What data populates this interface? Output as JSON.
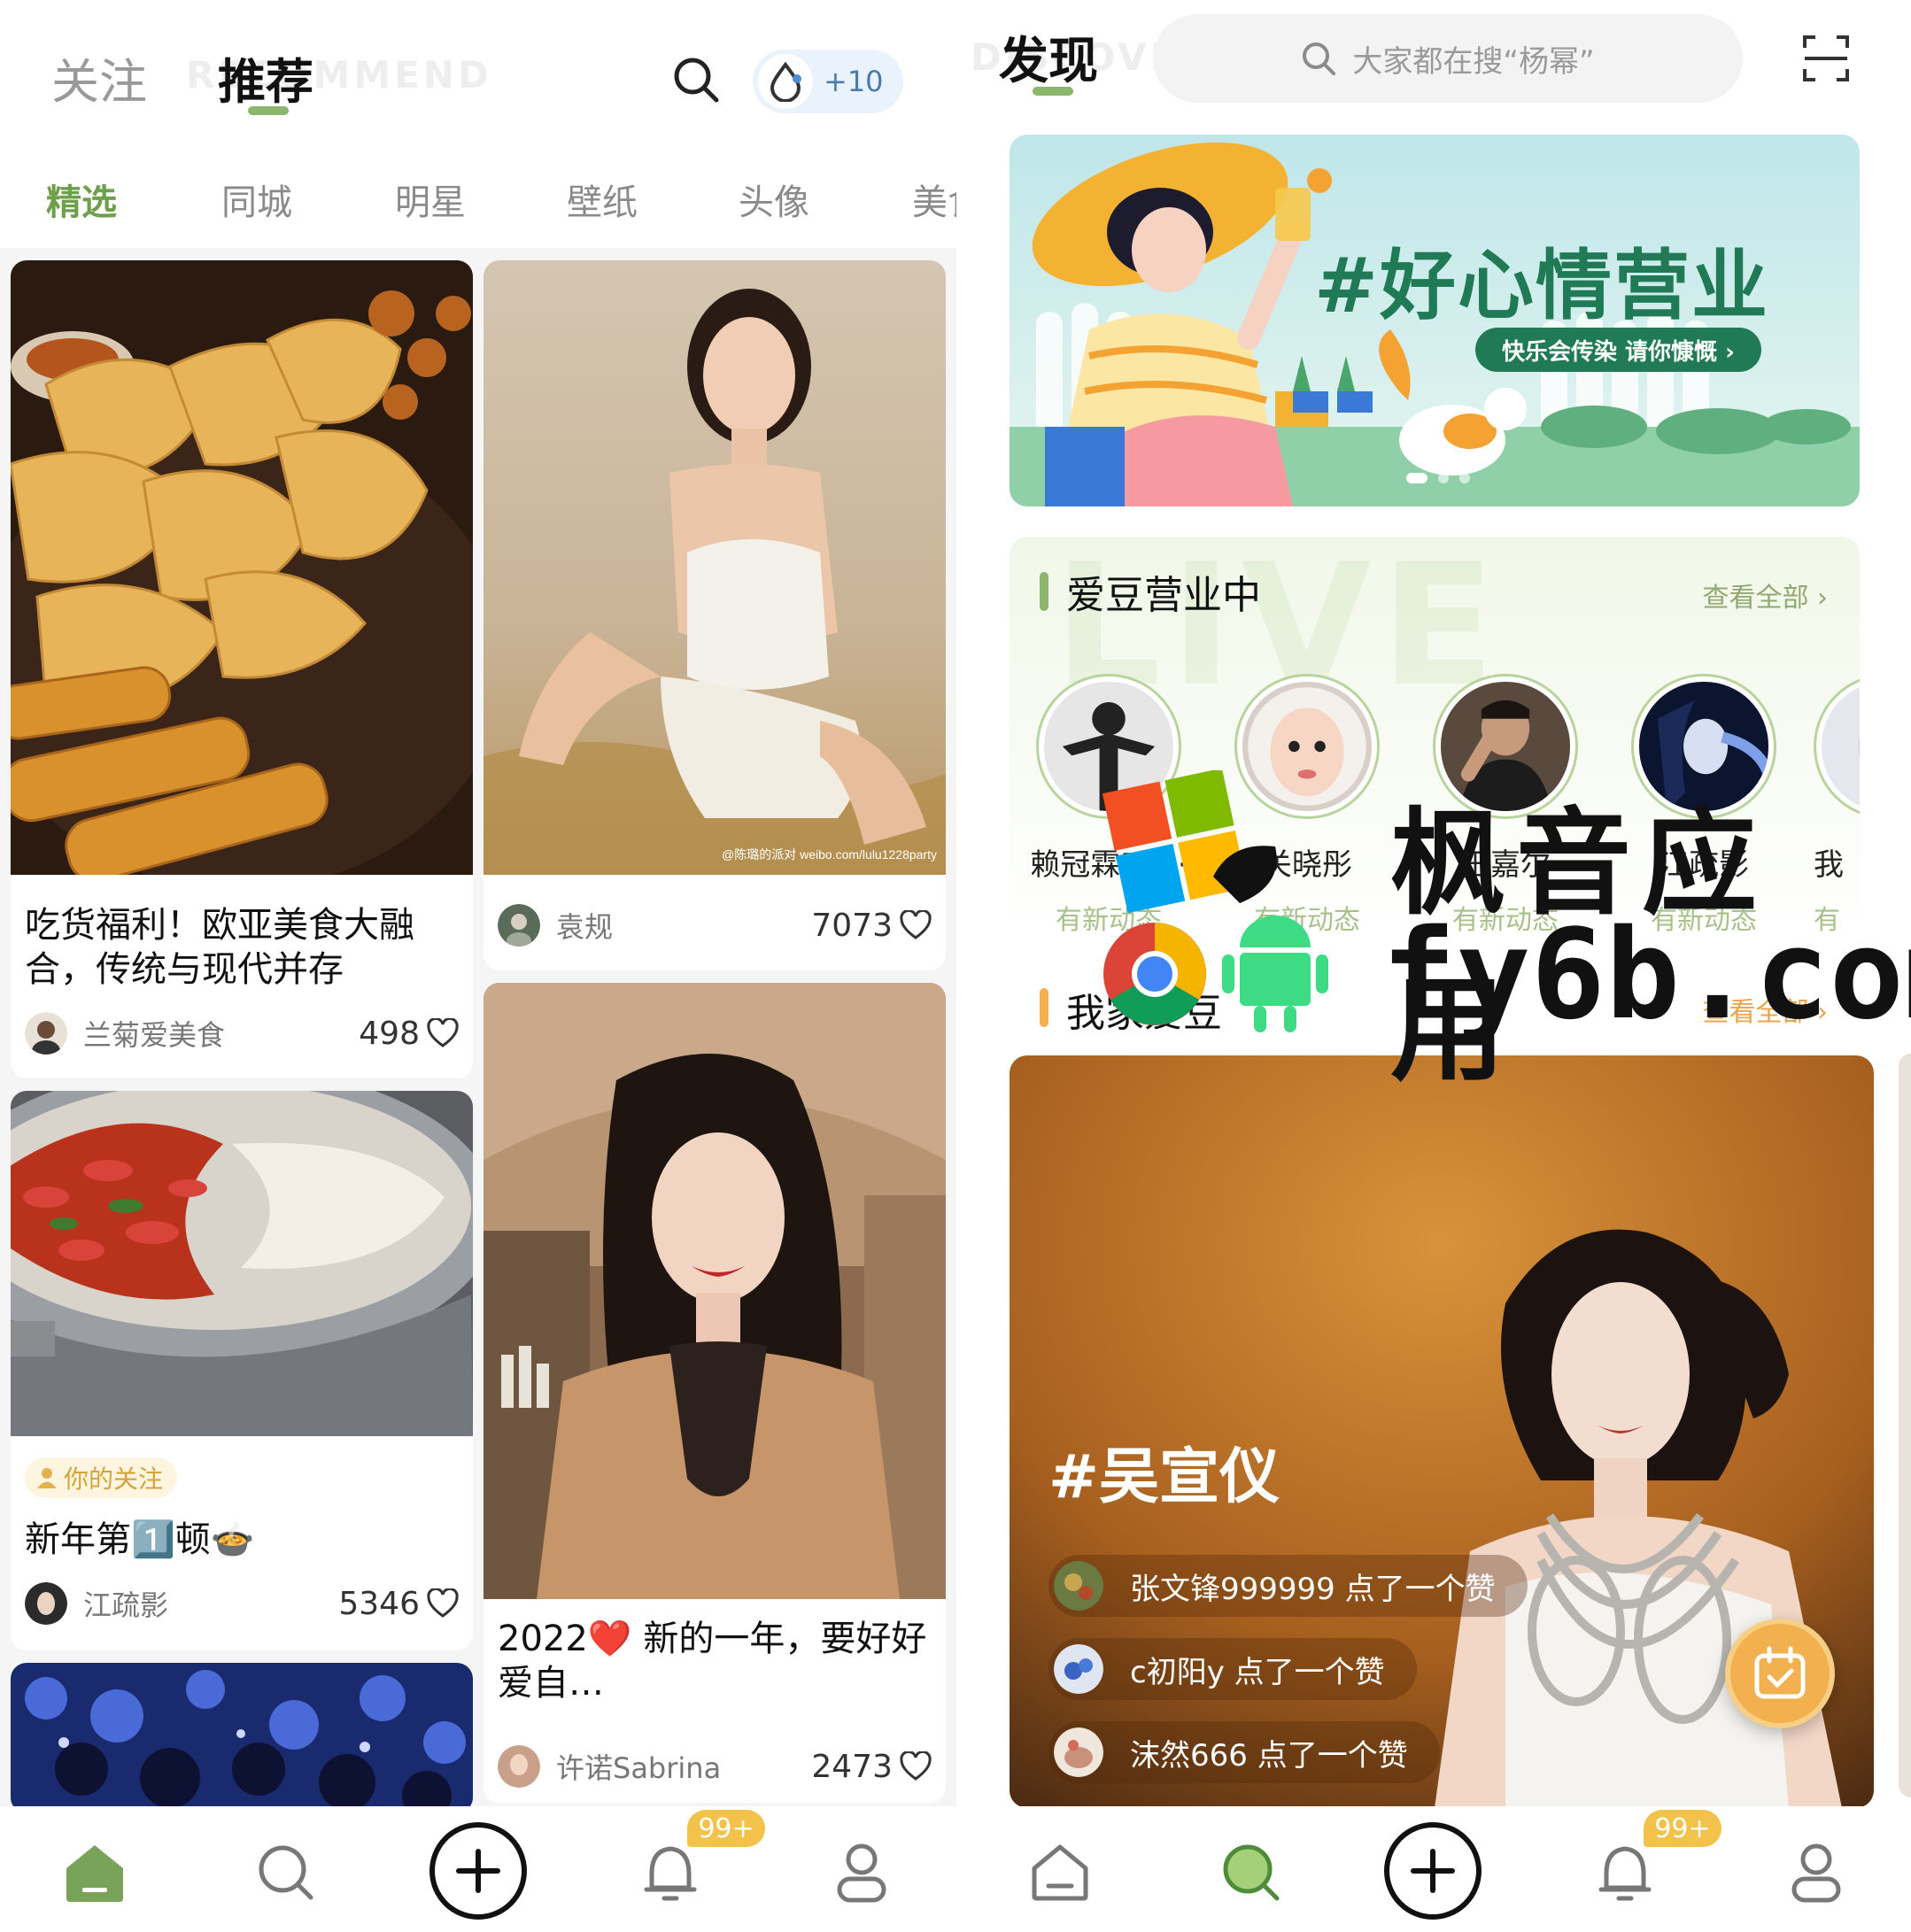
{
  "left": {
    "top_tabs": [
      {
        "label": "关注",
        "active": false
      },
      {
        "label": "推荐",
        "active": true
      }
    ],
    "ghost_label": "RECOMMEND",
    "points_badge": "+10",
    "categories": [
      {
        "label": "精选",
        "active": true
      },
      {
        "label": "同城",
        "active": false
      },
      {
        "label": "明星",
        "active": false
      },
      {
        "label": "壁纸",
        "active": false
      },
      {
        "label": "头像",
        "active": false
      },
      {
        "label": "美食",
        "active": false
      }
    ],
    "cards": [
      {
        "title": "吃货福利！欧亚美食大融合，传统与现代并存",
        "author": "兰菊爱美食",
        "likes": "498"
      },
      {
        "title": "",
        "author": "袁规",
        "likes": "7073",
        "watermark": "@陈璐的派对 weibo.com/lulu1228party"
      },
      {
        "follow_tag": "你的关注",
        "title": "新年第1️⃣顿🍲",
        "author": "江疏影",
        "likes": "5346"
      },
      {
        "title": "2022❤️ 新的一年，要好好爱自…",
        "author": "许诺Sabrina",
        "likes": "2473"
      }
    ]
  },
  "right": {
    "title": "发现",
    "ghost_label": "DISCOVER",
    "search_placeholder": "大家都在搜“杨幂”",
    "banner": {
      "title": "#好心情营业",
      "subtitle": "快乐会传染 请你慷慨 ›"
    },
    "live_section": {
      "title": "爱豆营业中",
      "see_all": "查看全部",
      "watermark": "LIVE",
      "idols": [
        {
          "name": "赖冠霖Ed···",
          "status": "有新动态"
        },
        {
          "name": "关晓彤",
          "status": "有新动态"
        },
        {
          "name": "王嘉尔",
          "status": "有新动态"
        },
        {
          "name": "江疏影",
          "status": "有新动态"
        },
        {
          "name": "我",
          "status": "有"
        }
      ]
    },
    "my_idol": {
      "title": "我家爱豆",
      "see_all": "查看全部"
    },
    "feature": {
      "hashtag": "#吴宣仪",
      "likes": [
        {
          "text": "张文锋999999 点了一个赞"
        },
        {
          "text": "c初阳y 点了一个赞"
        },
        {
          "text": "沫然666 点了一个赞"
        }
      ]
    }
  },
  "bottom_nav": {
    "badge": "99+"
  },
  "overlay_watermark": {
    "line1": "枫音应用",
    "line2": "fy6b.com"
  },
  "colors": {
    "accent_green": "#8cb56d",
    "badge_yellow": "#f2c24a",
    "fab_orange": "#f2b04f"
  }
}
